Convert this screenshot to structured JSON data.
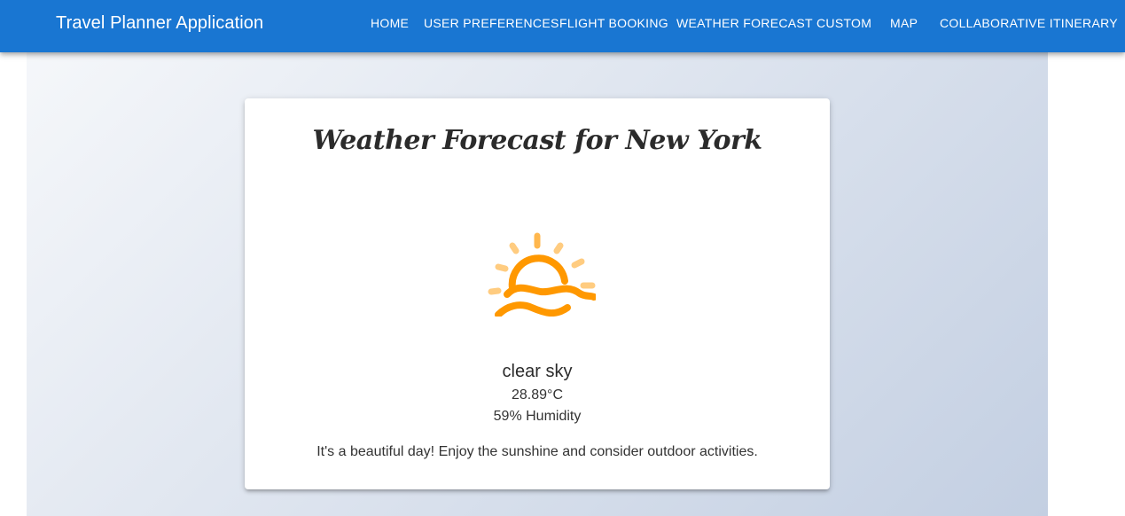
{
  "app": {
    "title": "Travel Planner Application"
  },
  "nav": {
    "items": [
      {
        "label": "HOME"
      },
      {
        "label": "USER PREFERENCES"
      },
      {
        "label": "FLIGHT BOOKING"
      },
      {
        "label": "WEATHER FORECAST"
      },
      {
        "label": "CUSTOM"
      },
      {
        "label": "MAP"
      },
      {
        "label": "COLLABORATIVE ITINERARY"
      }
    ]
  },
  "weather": {
    "title": "Weather Forecast for New York",
    "icon": "sunrise-icon",
    "description": "clear sky",
    "temperature": "28.89°C",
    "humidity": "59% Humidity",
    "advice": "It's a beautiful day! Enjoy the sunshine and consider outdoor activities."
  },
  "colors": {
    "appbar": "#1976d2",
    "icon_primary": "#ff9800",
    "icon_secondary": "#ffcc80",
    "background_gradient_start": "#f5f7fa",
    "background_gradient_end": "#c3cfe2"
  }
}
